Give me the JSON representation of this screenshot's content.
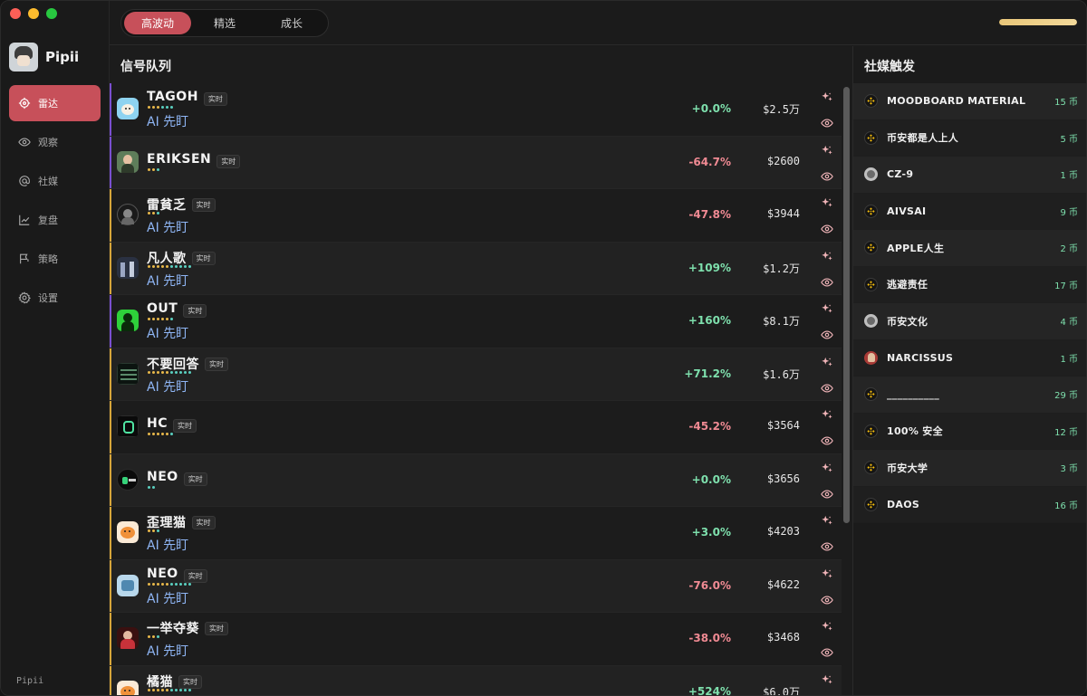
{
  "window": {
    "traffic_lights": [
      "close",
      "minimize",
      "maximize"
    ]
  },
  "sidebar": {
    "app_name": "Pipii",
    "footer": "Pipii",
    "items": [
      {
        "label": "雷达",
        "icon": "radar-icon",
        "active": true
      },
      {
        "label": "观察",
        "icon": "eye-icon",
        "active": false
      },
      {
        "label": "社媒",
        "icon": "at-icon",
        "active": false
      },
      {
        "label": "复盘",
        "icon": "chart-line-icon",
        "active": false
      },
      {
        "label": "策略",
        "icon": "flag-icon",
        "active": false
      },
      {
        "label": "设置",
        "icon": "gear-icon",
        "active": false
      }
    ]
  },
  "topbar": {
    "tabs": [
      {
        "label": "高波动",
        "active": true
      },
      {
        "label": "精选",
        "active": false
      },
      {
        "label": "成长",
        "active": false
      }
    ],
    "progress_fraction": 1.0
  },
  "signals": {
    "title": "信号队列",
    "live_label": "实时",
    "ai_label": "AI 先盯",
    "rows": [
      {
        "name": "TAGOH",
        "ai": true,
        "change": "+0.0%",
        "dir": "up",
        "amount": "$2.5万",
        "edge": "#7a4fd0",
        "icon": "tagoh",
        "dots": [
          "#e8b84a",
          "#e8b84a",
          "#e8b84a",
          "#5ad0c0",
          "#5ad0c0",
          "#5ad0c0"
        ]
      },
      {
        "name": "ERIKSEN",
        "ai": false,
        "change": "-64.7%",
        "dir": "down",
        "amount": "$2600",
        "edge": "#7a4fd0",
        "icon": "eriksen",
        "dots": [
          "#e8b84a",
          "#e8b84a",
          "#5ad0c0"
        ]
      },
      {
        "name": "雷貧乏",
        "ai": true,
        "change": "-47.8%",
        "dir": "down",
        "amount": "$3944",
        "edge": "#d6a53a",
        "icon": "lei",
        "dots": [
          "#e8b84a",
          "#e8b84a",
          "#5ad0c0"
        ]
      },
      {
        "name": "凡人歌",
        "ai": true,
        "change": "+109%",
        "dir": "up",
        "amount": "$1.2万",
        "edge": "#d6a53a",
        "icon": "fan",
        "dots": [
          "#e8b84a",
          "#e8b84a",
          "#e8b84a",
          "#e8b84a",
          "#e8b84a",
          "#5ad0c0",
          "#5ad0c0",
          "#5ad0c0",
          "#5ad0c0",
          "#5ad0c0"
        ]
      },
      {
        "name": "OUT",
        "ai": true,
        "change": "+160%",
        "dir": "up",
        "amount": "$8.1万",
        "edge": "#7a4fd0",
        "icon": "out",
        "dots": [
          "#e8b84a",
          "#e8b84a",
          "#e8b84a",
          "#e8b84a",
          "#e8b84a",
          "#5ad0c0"
        ]
      },
      {
        "name": "不要回答",
        "ai": true,
        "change": "+71.2%",
        "dir": "up",
        "amount": "$1.6万",
        "edge": "#d6a53a",
        "icon": "buyao",
        "dots": [
          "#e8b84a",
          "#e8b84a",
          "#e8b84a",
          "#e8b84a",
          "#e8b84a",
          "#5ad0c0",
          "#5ad0c0",
          "#5ad0c0",
          "#5ad0c0",
          "#5ad0c0"
        ]
      },
      {
        "name": "HC",
        "ai": false,
        "change": "-45.2%",
        "dir": "down",
        "amount": "$3564",
        "edge": "#d6a53a",
        "icon": "hc",
        "dots": [
          "#e8b84a",
          "#e8b84a",
          "#e8b84a",
          "#e8b84a",
          "#e8b84a",
          "#5ad0c0"
        ]
      },
      {
        "name": "NEO",
        "ai": false,
        "change": "+0.0%",
        "dir": "up",
        "amount": "$3656",
        "edge": "#d6a53a",
        "icon": "neo1",
        "dots": [
          "#5ad0c0",
          "#5ad0c0"
        ]
      },
      {
        "name": "歪理猫",
        "ai": true,
        "change": "+3.0%",
        "dir": "up",
        "amount": "$4203",
        "edge": "#d6a53a",
        "icon": "cat",
        "dots": [
          "#e8b84a",
          "#e8b84a",
          "#5ad0c0"
        ]
      },
      {
        "name": "NEO",
        "ai": true,
        "change": "-76.0%",
        "dir": "down",
        "amount": "$4622",
        "edge": "#d6a53a",
        "icon": "neo2",
        "dots": [
          "#e8b84a",
          "#e8b84a",
          "#e8b84a",
          "#e8b84a",
          "#e8b84a",
          "#5ad0c0",
          "#5ad0c0",
          "#5ad0c0",
          "#5ad0c0",
          "#5ad0c0"
        ]
      },
      {
        "name": "一举夺葵",
        "ai": true,
        "change": "-38.0%",
        "dir": "down",
        "amount": "$3468",
        "edge": "#d6a53a",
        "icon": "yiju",
        "dots": [
          "#e8b84a",
          "#e8b84a",
          "#5ad0c0"
        ]
      },
      {
        "name": "橘猫",
        "ai": true,
        "change": "+524%",
        "dir": "up",
        "amount": "$6.0万",
        "edge": "#d6a53a",
        "icon": "cat",
        "dots": [
          "#e8b84a",
          "#e8b84a",
          "#e8b84a",
          "#e8b84a",
          "#e8b84a",
          "#5ad0c0",
          "#5ad0c0",
          "#5ad0c0",
          "#5ad0c0",
          "#5ad0c0"
        ]
      }
    ]
  },
  "social": {
    "title": "社媒触发",
    "items": [
      {
        "name": "MOODBOARD MATERIAL",
        "count": "15 币",
        "icon": "bnb"
      },
      {
        "name": "币安都是人上人",
        "count": "5 币",
        "icon": "bnb"
      },
      {
        "name": "CZ-9",
        "count": "1 币",
        "icon": "face"
      },
      {
        "name": "AIVSAI",
        "count": "9 币",
        "icon": "bnb"
      },
      {
        "name": "APPLE人生",
        "count": "2 币",
        "icon": "bnb"
      },
      {
        "name": "逃避责任",
        "count": "17 币",
        "icon": "bnb"
      },
      {
        "name": "币安文化",
        "count": "4 币",
        "icon": "face"
      },
      {
        "name": "NARCISSUS",
        "count": "1 币",
        "icon": "red"
      },
      {
        "name": "__________",
        "count": "29 币",
        "icon": "bnb"
      },
      {
        "name": "100% 安全",
        "count": "12 币",
        "icon": "bnb"
      },
      {
        "name": "币安大学",
        "count": "3 币",
        "icon": "bnb"
      },
      {
        "name": "DAOS",
        "count": "16 币",
        "icon": "bnb"
      }
    ]
  },
  "colors": {
    "accent": "#c7505a",
    "up": "#7ee0ad",
    "down": "#f08a93",
    "ai": "#8fb6f5",
    "gold": "#e9c77a",
    "bnb": "#f0b90b"
  }
}
